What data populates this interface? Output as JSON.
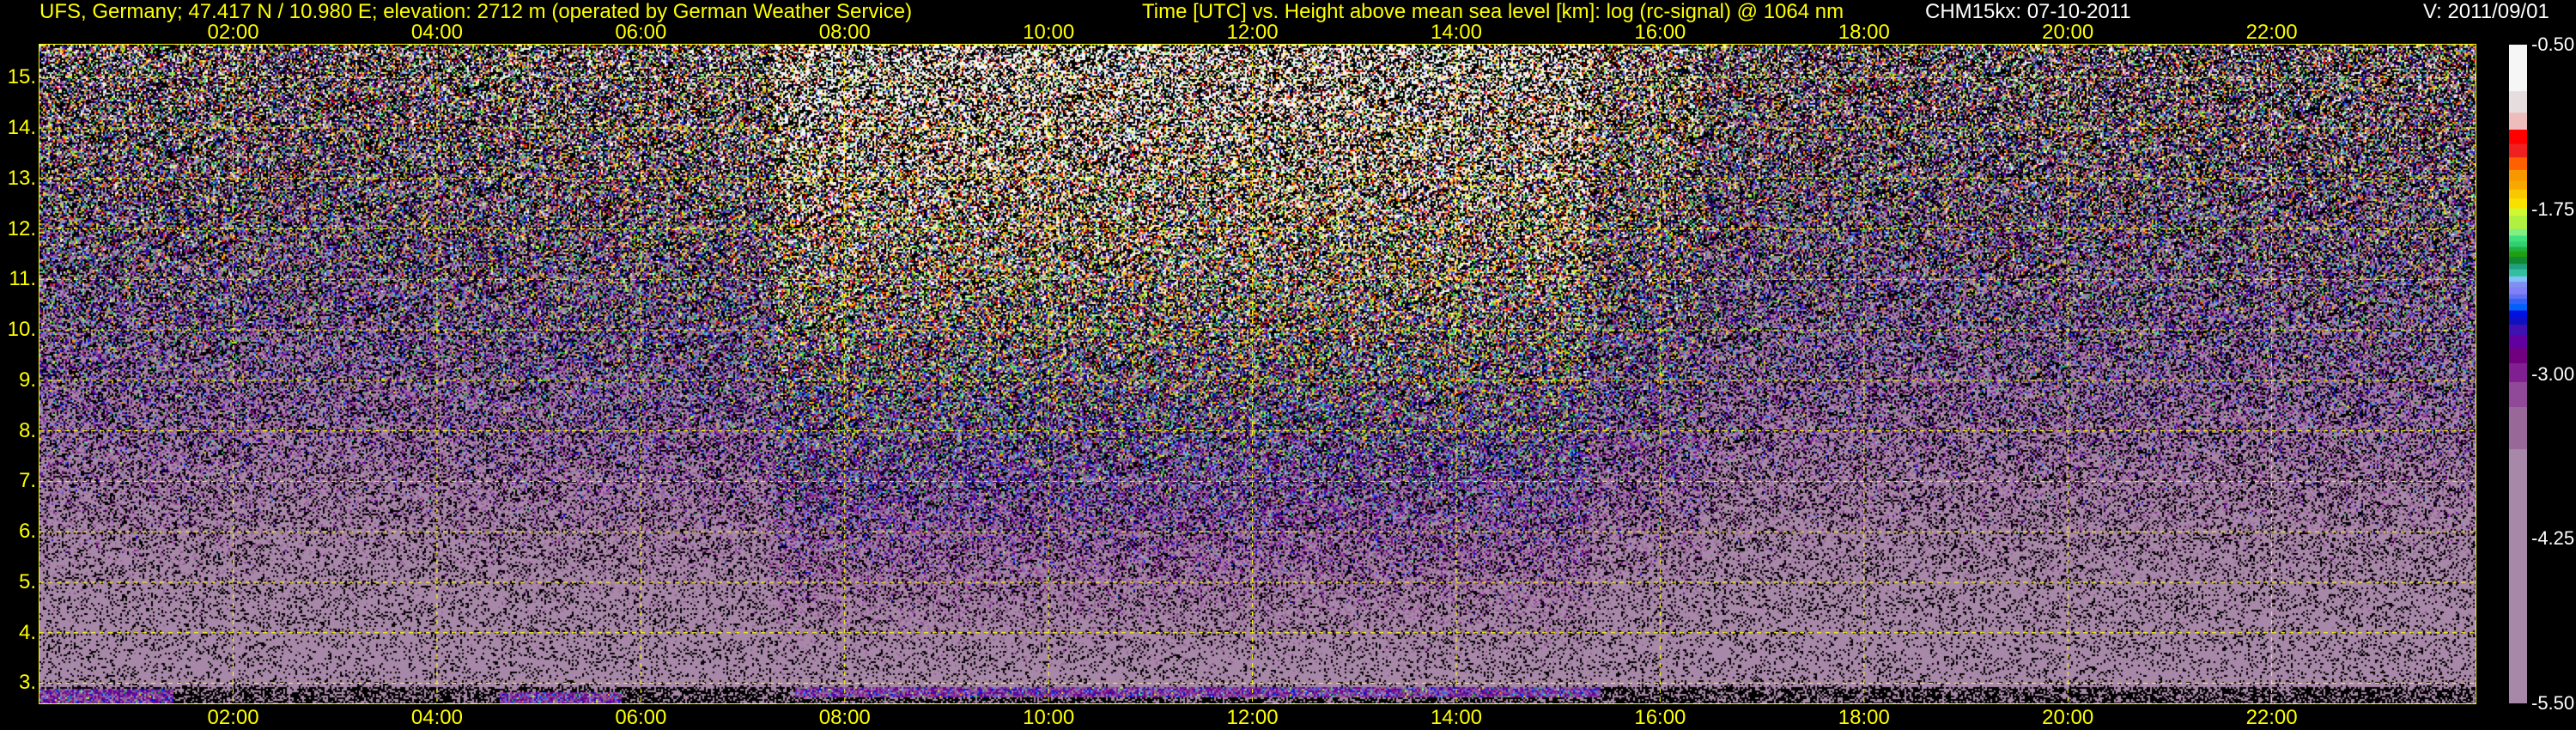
{
  "header": {
    "site": "UFS, Germany; 47.417 N / 10.980 E; elevation: 2712 m  (operated by German Weather Service)",
    "description": "Time [UTC] vs. Height above mean sea level [km]: log (rc-signal) @ 1064 nm",
    "instrument": "CHM15kx: 07-10-2011",
    "version": "V: 2011/09/01"
  },
  "chart_data": {
    "type": "heatmap",
    "title": "Time [UTC] vs. Height above mean sea level [km]: log (rc-signal) @ 1064 nm",
    "xlabel": "Time [UTC]",
    "ylabel": "Height above mean sea level [km]",
    "x_range_hours": [
      0.1,
      24.0
    ],
    "y_range_km": [
      2.6,
      15.65
    ],
    "x_ticks": [
      "02:00",
      "04:00",
      "06:00",
      "08:00",
      "10:00",
      "12:00",
      "14:00",
      "16:00",
      "18:00",
      "20:00",
      "22:00"
    ],
    "x_tick_hours": [
      2,
      4,
      6,
      8,
      10,
      12,
      14,
      16,
      18,
      20,
      22
    ],
    "y_ticks": [
      "3.",
      "4.",
      "5.",
      "6.",
      "7.",
      "8.",
      "9.",
      "10.",
      "11.",
      "12.",
      "13.",
      "14.",
      "15."
    ],
    "y_tick_km": [
      3,
      4,
      5,
      6,
      7,
      8,
      9,
      10,
      11,
      12,
      13,
      14,
      15
    ],
    "grid": true,
    "colorbar": {
      "range": [
        -5.5,
        -0.5
      ],
      "tick_labels": [
        "-0.50",
        "-1.75",
        "-3.00",
        "-4.25",
        "-5.50"
      ],
      "tick_values": [
        -0.5,
        -1.75,
        -3.0,
        -4.25,
        -5.5
      ],
      "colors_top_to_bottom": [
        "#f6f6f6",
        "#e6dede",
        "#efbcbc",
        "#ff0000",
        "#f02020",
        "#ff6000",
        "#f89800",
        "#f8a800",
        "#f8c800",
        "#f8e000",
        "#d0f830",
        "#b0f040",
        "#80f080",
        "#40e080",
        "#30d070",
        "#20b040",
        "#20a010",
        "#108830",
        "#20a080",
        "#30c0a0",
        "#80c0f8",
        "#8090f0",
        "#8080f8",
        "#6070f0",
        "#3060f8",
        "#0060f8",
        "#0010e0",
        "#1010c0",
        "#4010b0",
        "#6000a0",
        "#700080",
        "#802090",
        "#904898",
        "#986898",
        "#a888a8"
      ],
      "boundaries_top_to_bottom": [
        -0.853,
        -1.016,
        -1.145,
        -1.254,
        -1.356,
        -1.451,
        -1.533,
        -1.6,
        -1.668,
        -1.743,
        -1.798,
        -1.899,
        -1.95,
        -1.995,
        -2.035,
        -2.069,
        -2.11,
        -2.164,
        -2.205,
        -2.259,
        -2.3,
        -2.341,
        -2.395,
        -2.429,
        -2.47,
        -2.518,
        -2.572,
        -2.626,
        -2.708,
        -2.803,
        -2.918,
        -3.061,
        -3.251,
        -3.571
      ]
    }
  }
}
